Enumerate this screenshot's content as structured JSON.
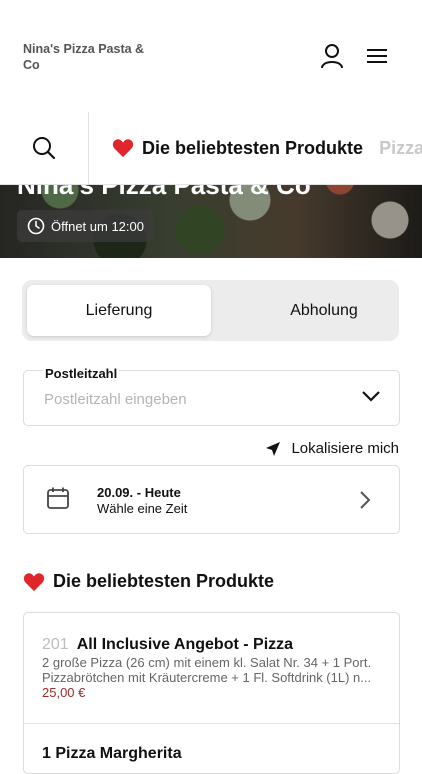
{
  "header": {
    "brand": "Nina's Pizza Pasta & Co"
  },
  "categories": {
    "items": [
      {
        "label": "Die beliebtesten Produkte",
        "icon": "heart-icon"
      },
      {
        "label": "Pizza"
      }
    ]
  },
  "hero": {
    "title": "Nina's Pizza Pasta & Co",
    "opening": "Öffnet um 12:00"
  },
  "order_mode": {
    "delivery": "Lieferung",
    "pickup": "Abholung",
    "selected": "Lieferung"
  },
  "postal": {
    "label": "Postleitzahl",
    "placeholder": "Postleitzahl eingeben",
    "value": ""
  },
  "locate_label": "Lokalisiere mich",
  "date": {
    "main": "20.09. - Heute",
    "sub": "Wähle eine Zeit"
  },
  "popular": {
    "title": "Die beliebtesten Produkte",
    "products": [
      {
        "number": "201",
        "name": "All Inclusive Angebot - Pizza",
        "description": "2 große Pizza (26 cm) mit einem kl. Salat Nr. 34 + 1 Port. Pizzabrötchen mit Kräutercreme + 1 Fl. Softdrink (1L) n...",
        "price": "25,00 €"
      },
      {
        "number": "",
        "name": "1 Pizza Margherita"
      }
    ]
  },
  "colors": {
    "accent": "#9b2a2a",
    "heart": "#e0262b"
  }
}
